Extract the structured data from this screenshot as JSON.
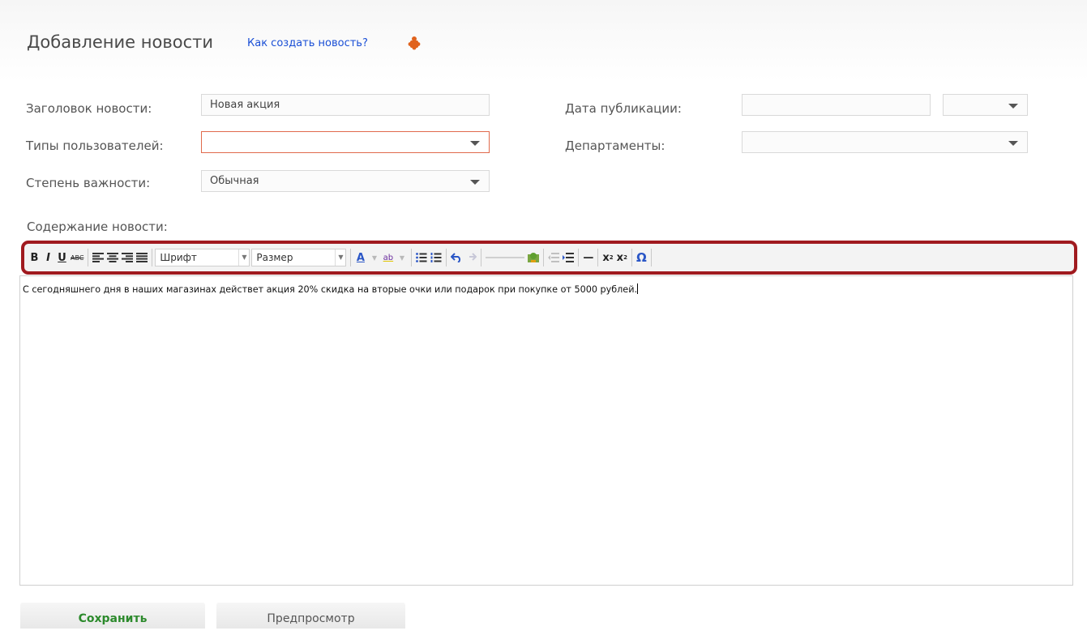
{
  "header": {
    "title": "Добавление новости",
    "help_link": "Как создать новость?",
    "help_icon": "orange-puzzle-icon"
  },
  "form": {
    "title_label": "Заголовок новости:",
    "title_value": "Новая акция",
    "user_types_label": "Типы пользователей:",
    "user_types_value": "",
    "importance_label": "Степень важности:",
    "importance_value": "Обычная",
    "pub_date_label": "Дата публикации:",
    "pub_date_value": "",
    "pub_time_value": "",
    "departments_label": "Департаменты:",
    "departments_value": "",
    "content_label": "Содержание новости:"
  },
  "toolbar": {
    "bold": "B",
    "italic": "I",
    "underline": "U",
    "strike": "ABC",
    "font_label": "Шрифт",
    "size_label": "Размер",
    "text_color": "A",
    "highlight": "ab",
    "subscript": "x",
    "superscript": "x",
    "special_char": "Ω",
    "hr": "—"
  },
  "editor": {
    "content": "С сегодняшнего дня в наших магазинах действет акция 20% скидка на вторые очки или подарок при покупке от 5000 рублей."
  },
  "buttons": {
    "save": "Сохранить",
    "preview": "Предпросмотр"
  },
  "colors": {
    "toolbar_highlight": "#a01a1f",
    "save_text": "#2c8a2c",
    "link": "#1a4fd6",
    "error_border": "#e06a4c"
  }
}
